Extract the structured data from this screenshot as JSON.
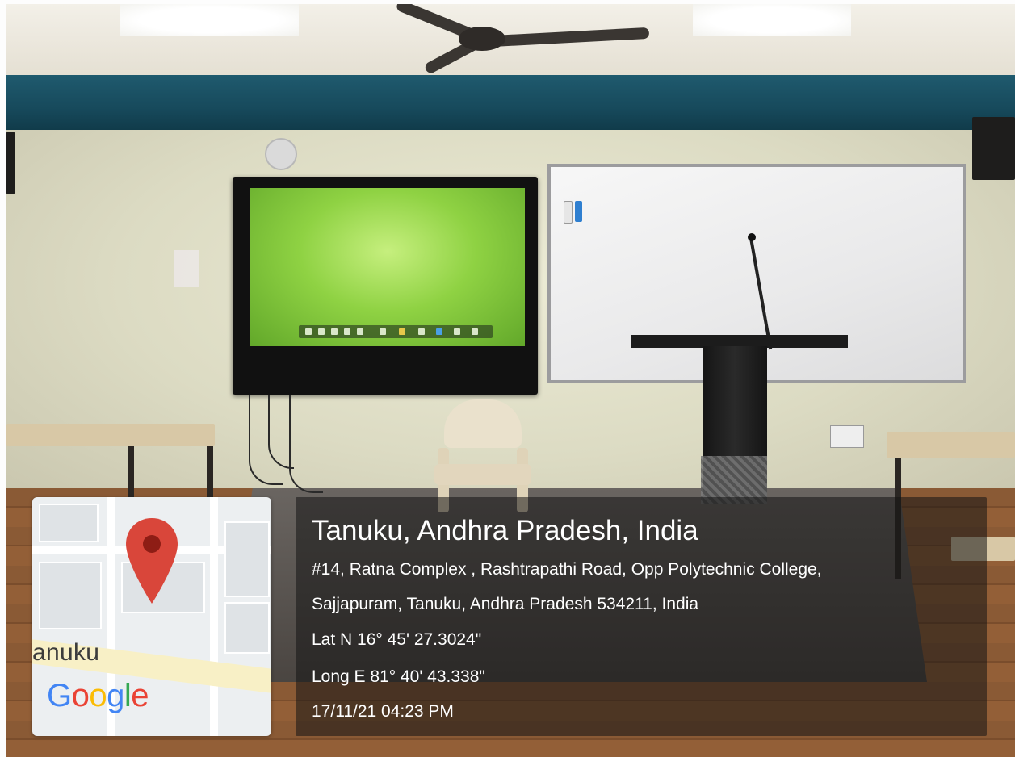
{
  "geotag": {
    "map": {
      "city_label": "anuku",
      "google_logo": {
        "letters": [
          "G",
          "o",
          "o",
          "g",
          "l",
          "e"
        ],
        "colors": [
          "#4285F4",
          "#EA4335",
          "#FBBC05",
          "#4285F4",
          "#34A853",
          "#EA4335"
        ]
      },
      "pin_icon": "map-pin-icon",
      "pin_color": "#D9463A"
    },
    "location_title": "Tanuku, Andhra Pradesh, India",
    "address_line_1": "#14, Ratna Complex , Rashtrapathi Road, Opp Polytechnic College,",
    "address_line_2": "Sajjapuram, Tanuku, Andhra Pradesh 534211, India",
    "latitude": "Lat N 16° 45' 27.3024\"",
    "longitude": "Long E 81° 40' 43.338\"",
    "datetime": "17/11/21 04:23 PM"
  }
}
